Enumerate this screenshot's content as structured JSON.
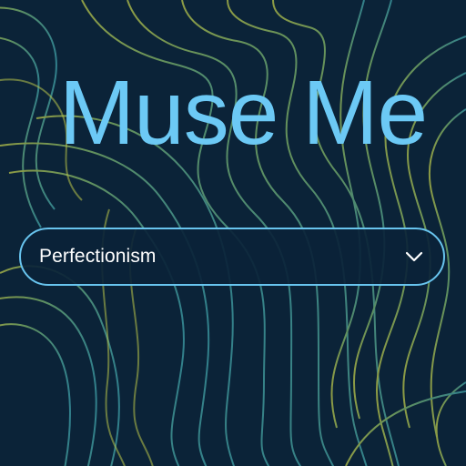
{
  "app": {
    "title": "Muse Me"
  },
  "topic_select": {
    "selected": "Perfectionism",
    "icon": "chevron-down-icon"
  },
  "colors": {
    "background": "#0b2338",
    "title": "#6cc9f5",
    "select_border": "#68c4ee",
    "contour_yellow": "#b8c44a",
    "contour_teal": "#3fa0a8",
    "select_text": "#ffffff"
  }
}
